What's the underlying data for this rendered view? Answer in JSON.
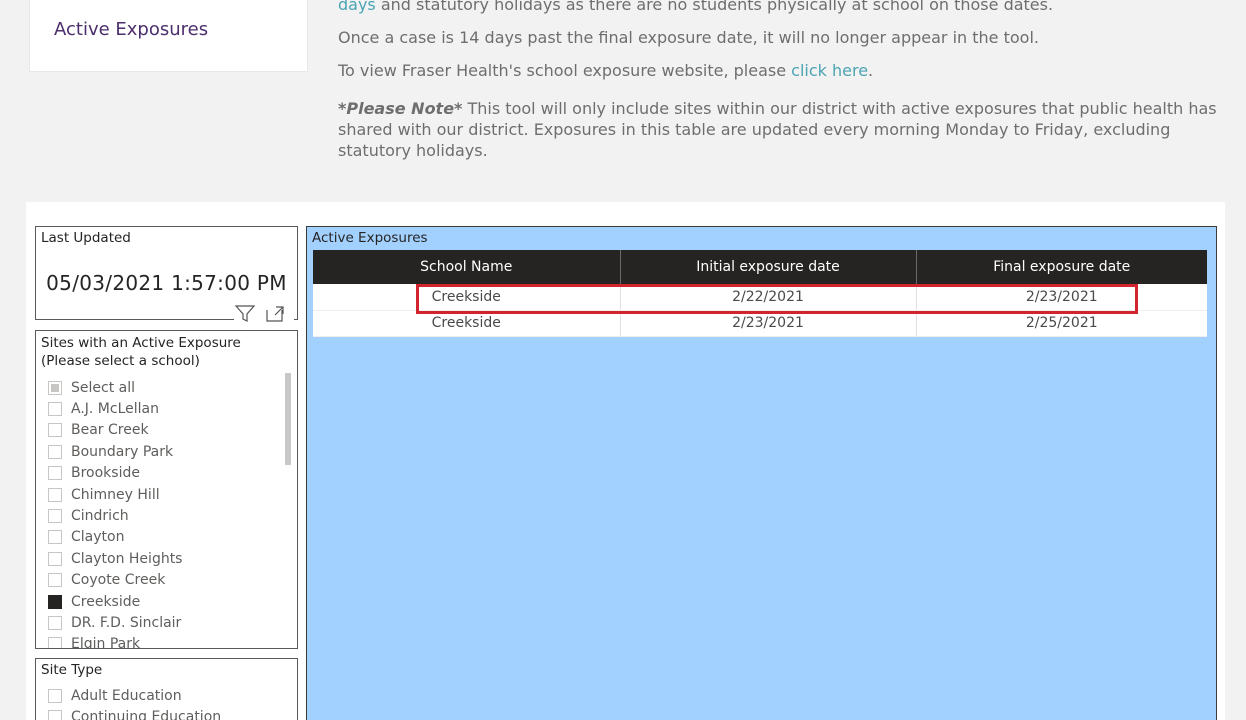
{
  "nav": {
    "active_label": "Active Exposures"
  },
  "intro": {
    "line1_link": "days",
    "line1_rest": " and statutory holidays as there are no students physically at school on those dates.",
    "line2": "Once a case is 14 days past the final exposure date, it will no longer appear in the tool.",
    "line3_pre": "To view Fraser Health's school exposure website, please ",
    "line3_link": "click here",
    "line3_post": ".",
    "note_label": "*Please Note*",
    "note_text": " This tool will only include sites within our district with active exposures that public health has shared with our district. Exposures in this table are updated every morning Monday to Friday, excluding statutory holidays."
  },
  "last_updated": {
    "title": "Last Updated",
    "value": "05/03/2021 1:57:00 PM"
  },
  "header_icons": {
    "filter": "filter-icon",
    "focus": "focus-mode-icon"
  },
  "sites_slicer": {
    "title_line1": "Sites with an Active Exposure",
    "title_line2": "(Please select a school)",
    "items": [
      {
        "label": "Select all",
        "state": "partial"
      },
      {
        "label": "A.J. McLellan",
        "state": "unchecked"
      },
      {
        "label": "Bear Creek",
        "state": "unchecked"
      },
      {
        "label": "Boundary Park",
        "state": "unchecked"
      },
      {
        "label": "Brookside",
        "state": "unchecked"
      },
      {
        "label": "Chimney Hill",
        "state": "unchecked"
      },
      {
        "label": "Cindrich",
        "state": "unchecked"
      },
      {
        "label": "Clayton",
        "state": "unchecked"
      },
      {
        "label": "Clayton Heights",
        "state": "unchecked"
      },
      {
        "label": "Coyote Creek",
        "state": "unchecked"
      },
      {
        "label": "Creekside",
        "state": "checked"
      },
      {
        "label": "DR. F.D. Sinclair",
        "state": "unchecked"
      },
      {
        "label": "Elgin Park",
        "state": "unchecked"
      }
    ]
  },
  "site_type_slicer": {
    "title": "Site Type",
    "items": [
      {
        "label": "Adult Education",
        "state": "unchecked"
      },
      {
        "label": "Continuing Education",
        "state": "unchecked"
      }
    ]
  },
  "exposures_table": {
    "title": "Active Exposures",
    "columns": [
      "School Name",
      "Initial exposure date",
      "Final exposure date"
    ],
    "rows": [
      [
        "Creekside",
        "2/22/2021",
        "2/23/2021"
      ],
      [
        "Creekside",
        "2/23/2021",
        "2/25/2021"
      ]
    ]
  },
  "colors": {
    "table_background": "#a3d1ff",
    "header_background": "#252423",
    "highlight_border": "#d3232e",
    "link": "#4aa4b3",
    "nav_text": "#4b2e6b"
  }
}
